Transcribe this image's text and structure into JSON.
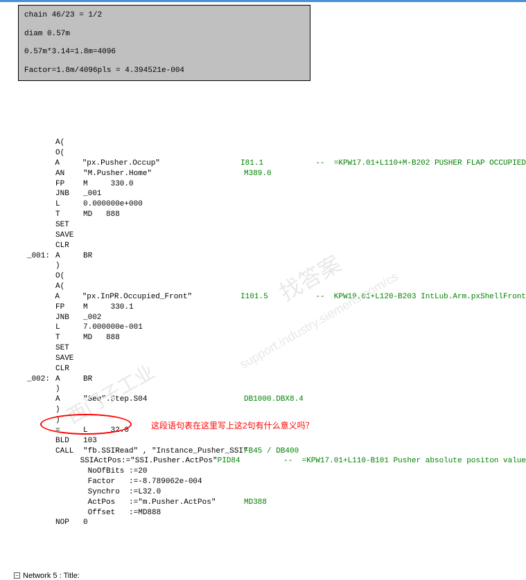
{
  "top_box": {
    "line1": "chain 46/23 = 1/2",
    "line2": "diam 0.57m",
    "line3": "0.57m*3.14=1.8m=4096",
    "line4": "Factor=1.8m/4096pls = 4.394521e-004"
  },
  "code": [
    {
      "label": "",
      "op": "A(",
      "operand": "",
      "addr": "",
      "comment": ""
    },
    {
      "label": "",
      "op": "O(",
      "operand": "",
      "addr": "",
      "comment": ""
    },
    {
      "label": "",
      "op": "A",
      "operand": "\"px.Pusher.Occup\"",
      "addr": "I81.1",
      "comment": "--  =KPW17.01+L110+M-B202 PUSHER FLAP OCCUPIED"
    },
    {
      "label": "",
      "op": "AN",
      "operand": "\"M.Pusher.Home\"",
      "addr": "M389.0",
      "comment": ""
    },
    {
      "label": "",
      "op": "FP",
      "operand": "M     330.0",
      "addr": "",
      "comment": ""
    },
    {
      "label": "",
      "op": "JNB",
      "operand": "_001",
      "addr": "",
      "comment": ""
    },
    {
      "label": "",
      "op": "L",
      "operand": "0.000000e+000",
      "addr": "",
      "comment": ""
    },
    {
      "label": "",
      "op": "T",
      "operand": "MD   888",
      "addr": "",
      "comment": ""
    },
    {
      "label": "",
      "op": "SET",
      "operand": "",
      "addr": "",
      "comment": ""
    },
    {
      "label": "",
      "op": "SAVE",
      "operand": "",
      "addr": "",
      "comment": ""
    },
    {
      "label": "",
      "op": "CLR",
      "operand": "",
      "addr": "",
      "comment": ""
    },
    {
      "label": "_001:",
      "op": "A",
      "operand": "BR",
      "addr": "",
      "comment": ""
    },
    {
      "label": "",
      "op": ")",
      "operand": "",
      "addr": "",
      "comment": ""
    },
    {
      "label": "",
      "op": "O(",
      "operand": "",
      "addr": "",
      "comment": ""
    },
    {
      "label": "",
      "op": "A(",
      "operand": "",
      "addr": "",
      "comment": ""
    },
    {
      "label": "",
      "op": "A",
      "operand": "\"px.InPR.Occupied_Front\"",
      "addr": "I101.5",
      "comment": "--  KPW19.01+L120-B203 IntLub.Arm.pxShellFront"
    },
    {
      "label": "",
      "op": "FP",
      "operand": "M     330.1",
      "addr": "",
      "comment": ""
    },
    {
      "label": "",
      "op": "JNB",
      "operand": "_002",
      "addr": "",
      "comment": ""
    },
    {
      "label": "",
      "op": "L",
      "operand": "7.000000e-001",
      "addr": "",
      "comment": ""
    },
    {
      "label": "",
      "op": "T",
      "operand": "MD   888",
      "addr": "",
      "comment": ""
    },
    {
      "label": "",
      "op": "SET",
      "operand": "",
      "addr": "",
      "comment": ""
    },
    {
      "label": "",
      "op": "SAVE",
      "operand": "",
      "addr": "",
      "comment": ""
    },
    {
      "label": "",
      "op": "CLR",
      "operand": "",
      "addr": "",
      "comment": ""
    },
    {
      "label": "_002:",
      "op": "A",
      "operand": "BR",
      "addr": "",
      "comment": ""
    },
    {
      "label": "",
      "op": ")",
      "operand": "",
      "addr": "",
      "comment": ""
    },
    {
      "label": "",
      "op": "A",
      "operand": "\"Seq\".Step.S04",
      "addr": "DB1000.DBX8.4",
      "comment": ""
    },
    {
      "label": "",
      "op": ")",
      "operand": "",
      "addr": "",
      "comment": ""
    },
    {
      "label": "",
      "op": ")",
      "operand": "",
      "addr": "",
      "comment": ""
    },
    {
      "label": "",
      "op": "=",
      "operand": "L     32.0",
      "addr": "",
      "comment": "",
      "circled": true
    },
    {
      "label": "",
      "op": "BLD",
      "operand": "103",
      "addr": "",
      "comment": ""
    },
    {
      "label": "",
      "op": "CALL",
      "operand": "\"fb.SSIRead\" , \"Instance_Pusher_SSI\"",
      "addr": "FB45 / DB400",
      "comment": ""
    },
    {
      "label": "",
      "op": "",
      "operand": " SSIActPos:=\"SSI.Pusher.ActPos\"",
      "addr": "PID84",
      "comment": "--  =KPW17.01+L110-B101 Pusher absolute positon value"
    },
    {
      "label": "",
      "op": "",
      "operand": " NoOfBits :=20",
      "addr": "",
      "comment": ""
    },
    {
      "label": "",
      "op": "",
      "operand": " Factor   :=-8.789062e-004",
      "addr": "",
      "comment": ""
    },
    {
      "label": "",
      "op": "",
      "operand": " Synchro  :=L32.0",
      "addr": "",
      "comment": ""
    },
    {
      "label": "",
      "op": "",
      "operand": " ActPos   :=\"m.Pusher.ActPos\"",
      "addr": "MD388",
      "comment": ""
    },
    {
      "label": "",
      "op": "",
      "operand": " Offset   :=MD888",
      "addr": "",
      "comment": ""
    },
    {
      "label": "",
      "op": "NOP",
      "operand": "0",
      "addr": "",
      "comment": ""
    }
  ],
  "red_annotation": "这段语句表在这里写上这2句有什么意义吗？",
  "watermarks": {
    "wm1": "西门子工业",
    "wm2": "support.industry.siemens.com/cs",
    "wm3": "找答案"
  },
  "footer": "Network 5 : Title:"
}
